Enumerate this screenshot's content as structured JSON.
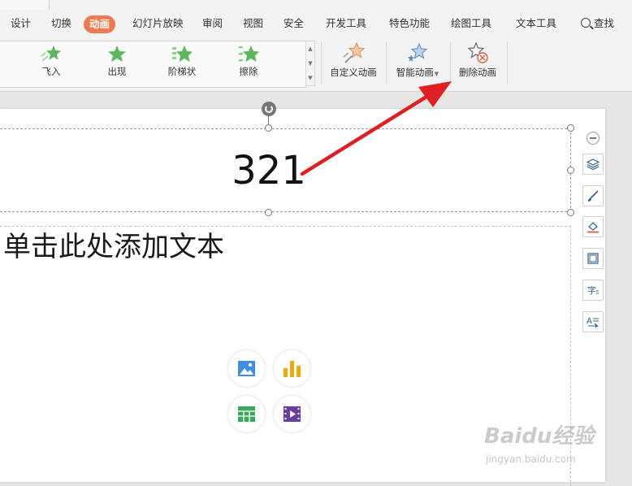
{
  "menu": {
    "tabs": [
      {
        "label": "设计"
      },
      {
        "label": "切换"
      },
      {
        "label": "动画",
        "active": true
      },
      {
        "label": "幻灯片放映"
      },
      {
        "label": "审阅"
      },
      {
        "label": "视图"
      },
      {
        "label": "安全"
      },
      {
        "label": "开发工具"
      },
      {
        "label": "特色功能"
      },
      {
        "label": "绘图工具"
      },
      {
        "label": "文本工具"
      }
    ],
    "search_label": "查找"
  },
  "ribbon": {
    "animations": [
      {
        "label": "飞入",
        "icon": "fly-in-star-icon"
      },
      {
        "label": "出现",
        "icon": "appear-star-icon"
      },
      {
        "label": "阶梯状",
        "icon": "stairs-star-icon"
      },
      {
        "label": "擦除",
        "icon": "wipe-star-icon"
      }
    ],
    "custom_animation": "自定义动画",
    "smart_animation": "智能动画",
    "delete_animation": "删除动画"
  },
  "slide": {
    "title": "321",
    "body_placeholder": "单击此处添加文本"
  },
  "watermark": {
    "brand": "Baidu经验",
    "url": "jingyan.baidu.com"
  },
  "colors": {
    "accent": "#ef7a52",
    "arrow": "#e02020",
    "star_green": "#5cb85c"
  }
}
